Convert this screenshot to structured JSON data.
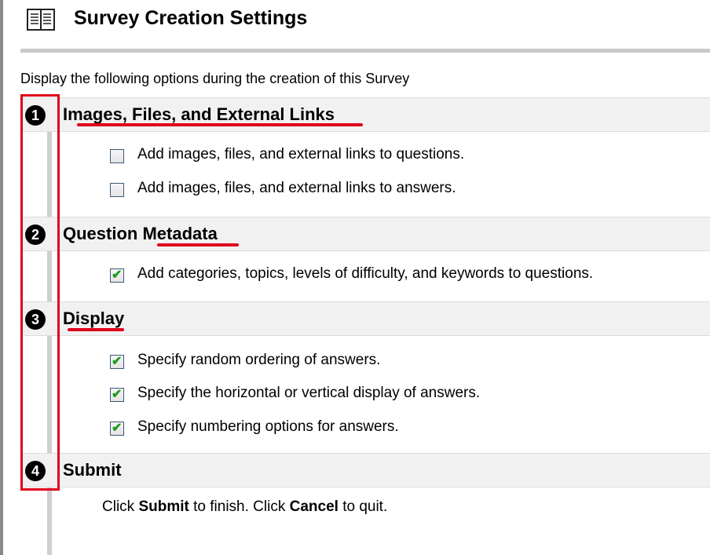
{
  "header": {
    "title": "Survey Creation Settings",
    "icon": "book-icon"
  },
  "intro_text": "Display the following options during the creation of this Survey",
  "sections": [
    {
      "number": "1",
      "title": "Images, Files, and External Links",
      "options": [
        {
          "label": "Add images, files, and external links to questions.",
          "checked": false
        },
        {
          "label": "Add images, files, and external links to answers.",
          "checked": false
        }
      ]
    },
    {
      "number": "2",
      "title": "Question Metadata",
      "options": [
        {
          "label": "Add categories, topics, levels of difficulty, and keywords to questions.",
          "checked": true
        }
      ]
    },
    {
      "number": "3",
      "title": "Display",
      "options": [
        {
          "label": "Specify random ordering of answers.",
          "checked": true
        },
        {
          "label": "Specify the horizontal or vertical display of answers.",
          "checked": true
        },
        {
          "label": "Specify numbering options for answers.",
          "checked": true
        }
      ]
    },
    {
      "number": "4",
      "title": "Submit"
    }
  ],
  "submit_instructions": {
    "part1": "Click ",
    "submit": "Submit",
    "part2": " to finish. Click ",
    "cancel": "Cancel",
    "part3": " to quit."
  },
  "annotation_color": "#e0001b"
}
